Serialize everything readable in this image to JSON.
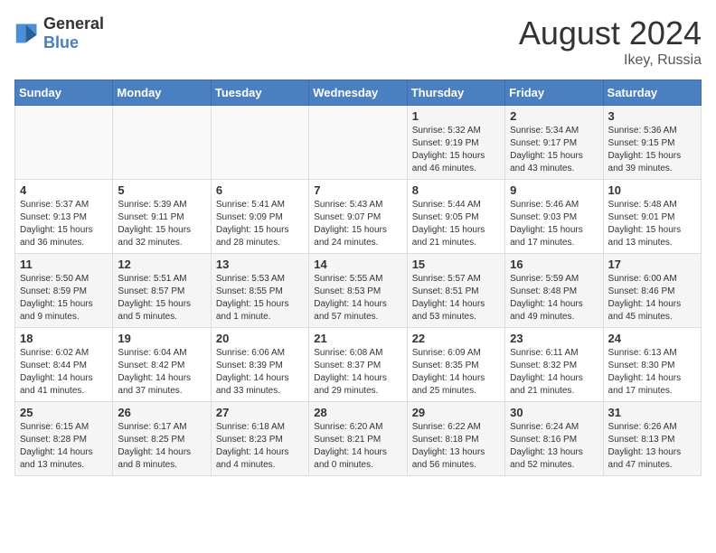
{
  "header": {
    "logo_line1": "General",
    "logo_line2": "Blue",
    "month_year": "August 2024",
    "location": "Ikey, Russia"
  },
  "weekdays": [
    "Sunday",
    "Monday",
    "Tuesday",
    "Wednesday",
    "Thursday",
    "Friday",
    "Saturday"
  ],
  "weeks": [
    [
      {
        "day": "",
        "sunrise": "",
        "sunset": "",
        "daylight": ""
      },
      {
        "day": "",
        "sunrise": "",
        "sunset": "",
        "daylight": ""
      },
      {
        "day": "",
        "sunrise": "",
        "sunset": "",
        "daylight": ""
      },
      {
        "day": "",
        "sunrise": "",
        "sunset": "",
        "daylight": ""
      },
      {
        "day": "1",
        "sunrise": "Sunrise: 5:32 AM",
        "sunset": "Sunset: 9:19 PM",
        "daylight": "Daylight: 15 hours and 46 minutes."
      },
      {
        "day": "2",
        "sunrise": "Sunrise: 5:34 AM",
        "sunset": "Sunset: 9:17 PM",
        "daylight": "Daylight: 15 hours and 43 minutes."
      },
      {
        "day": "3",
        "sunrise": "Sunrise: 5:36 AM",
        "sunset": "Sunset: 9:15 PM",
        "daylight": "Daylight: 15 hours and 39 minutes."
      }
    ],
    [
      {
        "day": "4",
        "sunrise": "Sunrise: 5:37 AM",
        "sunset": "Sunset: 9:13 PM",
        "daylight": "Daylight: 15 hours and 36 minutes."
      },
      {
        "day": "5",
        "sunrise": "Sunrise: 5:39 AM",
        "sunset": "Sunset: 9:11 PM",
        "daylight": "Daylight: 15 hours and 32 minutes."
      },
      {
        "day": "6",
        "sunrise": "Sunrise: 5:41 AM",
        "sunset": "Sunset: 9:09 PM",
        "daylight": "Daylight: 15 hours and 28 minutes."
      },
      {
        "day": "7",
        "sunrise": "Sunrise: 5:43 AM",
        "sunset": "Sunset: 9:07 PM",
        "daylight": "Daylight: 15 hours and 24 minutes."
      },
      {
        "day": "8",
        "sunrise": "Sunrise: 5:44 AM",
        "sunset": "Sunset: 9:05 PM",
        "daylight": "Daylight: 15 hours and 21 minutes."
      },
      {
        "day": "9",
        "sunrise": "Sunrise: 5:46 AM",
        "sunset": "Sunset: 9:03 PM",
        "daylight": "Daylight: 15 hours and 17 minutes."
      },
      {
        "day": "10",
        "sunrise": "Sunrise: 5:48 AM",
        "sunset": "Sunset: 9:01 PM",
        "daylight": "Daylight: 15 hours and 13 minutes."
      }
    ],
    [
      {
        "day": "11",
        "sunrise": "Sunrise: 5:50 AM",
        "sunset": "Sunset: 8:59 PM",
        "daylight": "Daylight: 15 hours and 9 minutes."
      },
      {
        "day": "12",
        "sunrise": "Sunrise: 5:51 AM",
        "sunset": "Sunset: 8:57 PM",
        "daylight": "Daylight: 15 hours and 5 minutes."
      },
      {
        "day": "13",
        "sunrise": "Sunrise: 5:53 AM",
        "sunset": "Sunset: 8:55 PM",
        "daylight": "Daylight: 15 hours and 1 minute."
      },
      {
        "day": "14",
        "sunrise": "Sunrise: 5:55 AM",
        "sunset": "Sunset: 8:53 PM",
        "daylight": "Daylight: 14 hours and 57 minutes."
      },
      {
        "day": "15",
        "sunrise": "Sunrise: 5:57 AM",
        "sunset": "Sunset: 8:51 PM",
        "daylight": "Daylight: 14 hours and 53 minutes."
      },
      {
        "day": "16",
        "sunrise": "Sunrise: 5:59 AM",
        "sunset": "Sunset: 8:48 PM",
        "daylight": "Daylight: 14 hours and 49 minutes."
      },
      {
        "day": "17",
        "sunrise": "Sunrise: 6:00 AM",
        "sunset": "Sunset: 8:46 PM",
        "daylight": "Daylight: 14 hours and 45 minutes."
      }
    ],
    [
      {
        "day": "18",
        "sunrise": "Sunrise: 6:02 AM",
        "sunset": "Sunset: 8:44 PM",
        "daylight": "Daylight: 14 hours and 41 minutes."
      },
      {
        "day": "19",
        "sunrise": "Sunrise: 6:04 AM",
        "sunset": "Sunset: 8:42 PM",
        "daylight": "Daylight: 14 hours and 37 minutes."
      },
      {
        "day": "20",
        "sunrise": "Sunrise: 6:06 AM",
        "sunset": "Sunset: 8:39 PM",
        "daylight": "Daylight: 14 hours and 33 minutes."
      },
      {
        "day": "21",
        "sunrise": "Sunrise: 6:08 AM",
        "sunset": "Sunset: 8:37 PM",
        "daylight": "Daylight: 14 hours and 29 minutes."
      },
      {
        "day": "22",
        "sunrise": "Sunrise: 6:09 AM",
        "sunset": "Sunset: 8:35 PM",
        "daylight": "Daylight: 14 hours and 25 minutes."
      },
      {
        "day": "23",
        "sunrise": "Sunrise: 6:11 AM",
        "sunset": "Sunset: 8:32 PM",
        "daylight": "Daylight: 14 hours and 21 minutes."
      },
      {
        "day": "24",
        "sunrise": "Sunrise: 6:13 AM",
        "sunset": "Sunset: 8:30 PM",
        "daylight": "Daylight: 14 hours and 17 minutes."
      }
    ],
    [
      {
        "day": "25",
        "sunrise": "Sunrise: 6:15 AM",
        "sunset": "Sunset: 8:28 PM",
        "daylight": "Daylight: 14 hours and 13 minutes."
      },
      {
        "day": "26",
        "sunrise": "Sunrise: 6:17 AM",
        "sunset": "Sunset: 8:25 PM",
        "daylight": "Daylight: 14 hours and 8 minutes."
      },
      {
        "day": "27",
        "sunrise": "Sunrise: 6:18 AM",
        "sunset": "Sunset: 8:23 PM",
        "daylight": "Daylight: 14 hours and 4 minutes."
      },
      {
        "day": "28",
        "sunrise": "Sunrise: 6:20 AM",
        "sunset": "Sunset: 8:21 PM",
        "daylight": "Daylight: 14 hours and 0 minutes."
      },
      {
        "day": "29",
        "sunrise": "Sunrise: 6:22 AM",
        "sunset": "Sunset: 8:18 PM",
        "daylight": "Daylight: 13 hours and 56 minutes."
      },
      {
        "day": "30",
        "sunrise": "Sunrise: 6:24 AM",
        "sunset": "Sunset: 8:16 PM",
        "daylight": "Daylight: 13 hours and 52 minutes."
      },
      {
        "day": "31",
        "sunrise": "Sunrise: 6:26 AM",
        "sunset": "Sunset: 8:13 PM",
        "daylight": "Daylight: 13 hours and 47 minutes."
      }
    ]
  ]
}
